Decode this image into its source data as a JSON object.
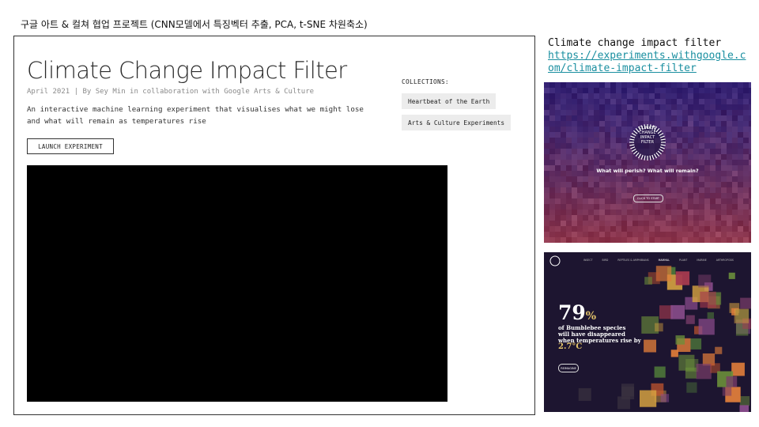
{
  "slide": {
    "title": "구글 아트 & 컬쳐 협업 프로젝트 (CNN모델에서 특징벡터 추출, PCA, t-SNE 차원축소)"
  },
  "page": {
    "title": "Climate Change Impact Filter",
    "byline": "April 2021 | By Sey Min in collaboration with Google Arts & Culture",
    "description": "An interactive machine learning experiment that visualises what we might lose and what will remain as temperatures rise",
    "launch_label": "LAUNCH EXPERIMENT",
    "collections_label": "COLLECTIONS:",
    "collections": [
      "Heartbeat of the Earth",
      "Arts & Culture Experiments"
    ]
  },
  "side": {
    "title": "Climate change impact filter",
    "link": "https://experiments.withgoogle.com/climate-impact-filter"
  },
  "thumb1": {
    "badge": [
      "CLIMATE",
      "CHANGE",
      "IMPACT",
      "FILTER"
    ],
    "question": "What will perish? What will remain?",
    "button": "CLICK TO START"
  },
  "thumb2": {
    "percent_number": "79",
    "percent_sign": "%",
    "caption_line1": "of Bumblebee species",
    "caption_line2": "will have disappeared",
    "caption_line3": "when temperatures rise by",
    "temperature": "2.7°C",
    "button": "REIMAGINE",
    "nav": [
      "INSECT",
      "BIRD",
      "REPTILES & AMPHIBIANS",
      "MAMMAL",
      "PLANT",
      "MARINE",
      "ARTHROPODS"
    ],
    "nav_active": "MAMMAL"
  },
  "colors": {
    "link": "#1a8fa0",
    "chip_bg": "#ececec",
    "accent_gold": "#e3c36a"
  }
}
